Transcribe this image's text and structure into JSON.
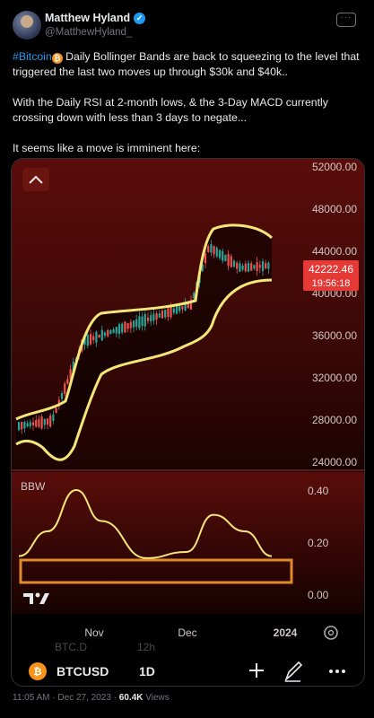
{
  "author": {
    "name": "Matthew Hyland",
    "handle": "@MatthewHyland_"
  },
  "tweet": {
    "hashtag": "#Bitcoin",
    "line1_rest": " Daily Bollinger Bands are back to squeezing to the level that triggered the last two moves up through $30k and $40k..",
    "para2": "With the Daily RSI at 2-month lows, & the 3-Day MACD currently crossing down with less than 3 days to negate...",
    "para3": "It seems like a move is imminent here:"
  },
  "chart": {
    "price_axis": [
      "52000.00",
      "48000.00",
      "44000.00",
      "40000.00",
      "36000.00",
      "32000.00",
      "28000.00",
      "24000.00"
    ],
    "price_label": "42222.46",
    "countdown": "19:56:18",
    "indicator_name": "BBW",
    "bbw_axis": [
      "0.40",
      "0.20",
      "0.00"
    ],
    "time_axis": [
      "Nov",
      "Dec",
      "2024"
    ],
    "partial_labels": [
      "BTC.D",
      "12h"
    ],
    "symbol": "BTCUSD",
    "interval": "1D",
    "colors": {
      "up": "#26a69a",
      "down": "#ef5350",
      "band": "#f5e67a",
      "highlight": "#e08a2b",
      "price_badge": "#e53935"
    }
  },
  "chart_data": [
    {
      "type": "line",
      "title": "",
      "series_note": "BTCUSD daily candles with Bollinger Bands",
      "x": [
        "Oct 1",
        "Oct 15",
        "Nov 1",
        "Nov 15",
        "Dec 1",
        "Dec 6",
        "Dec 15",
        "Dec 27"
      ],
      "series": [
        {
          "name": "",
          "values": [
            27000,
            27500,
            35000,
            36500,
            38500,
            44000,
            42000,
            42222
          ]
        }
      ],
      "ylim": [
        24000,
        52000
      ]
    },
    {
      "type": "line",
      "title": "BBW",
      "x": [
        "Oct 1",
        "Oct 20",
        "Nov 1",
        "Nov 10",
        "Nov 25",
        "Dec 5",
        "Dec 12",
        "Dec 20",
        "Dec 27"
      ],
      "series": [
        {
          "name": "BBW",
          "values": [
            0.08,
            0.2,
            0.4,
            0.25,
            0.07,
            0.1,
            0.28,
            0.2,
            0.08
          ]
        }
      ],
      "ylim": [
        0,
        0.45
      ]
    }
  ],
  "footer": {
    "time": "11:05 AM",
    "date": "Dec 27, 2023",
    "views": "60.4K",
    "views_label": "Views"
  }
}
